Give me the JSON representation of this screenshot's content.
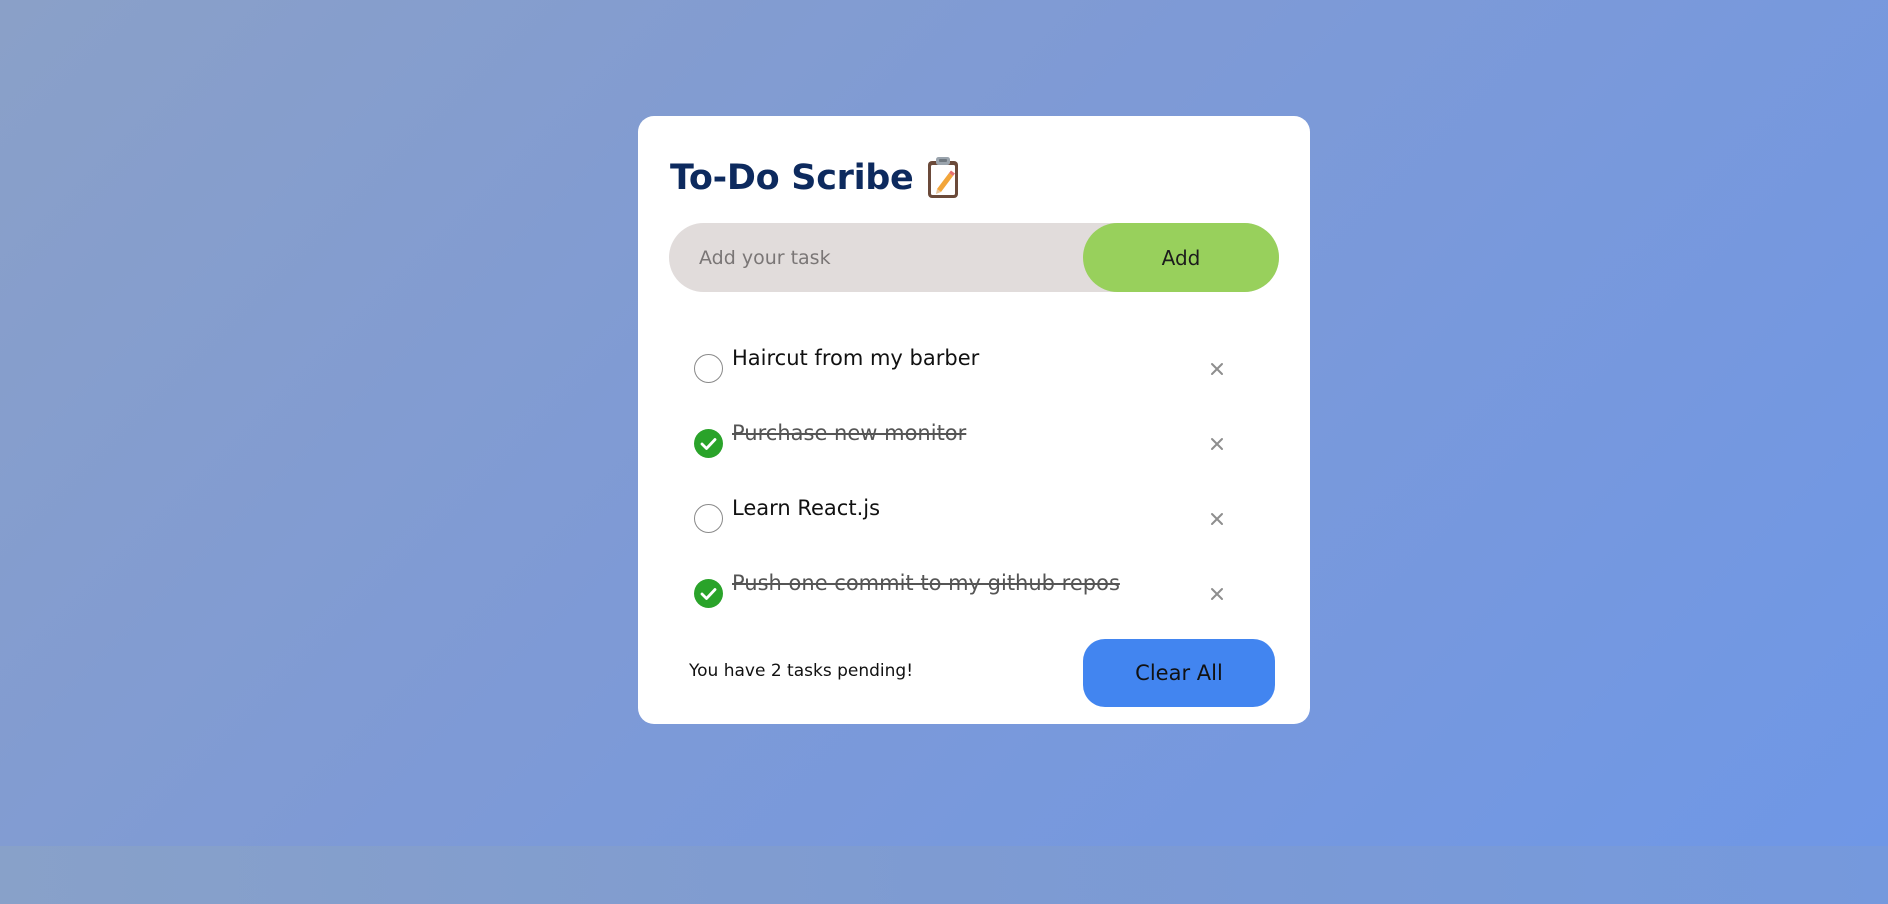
{
  "app": {
    "title": "To-Do Scribe",
    "title_icon": "clipboard-pencil-icon"
  },
  "input": {
    "placeholder": "Add your task",
    "value": ""
  },
  "add_button": {
    "label": "Add"
  },
  "tasks": [
    {
      "text": "Haircut from my barber",
      "done": false
    },
    {
      "text": "Purchase new monitor",
      "done": true
    },
    {
      "text": "Learn React.js",
      "done": false
    },
    {
      "text": "Push one commit to my github repos",
      "done": true
    }
  ],
  "footer": {
    "pending_text": "You have 2 tasks pending!",
    "clear_label": "Clear All"
  },
  "colors": {
    "accent_add": "#98d05c",
    "accent_clear": "#4285f0",
    "check_done": "#2aa32a",
    "title": "#0d2a5e"
  }
}
